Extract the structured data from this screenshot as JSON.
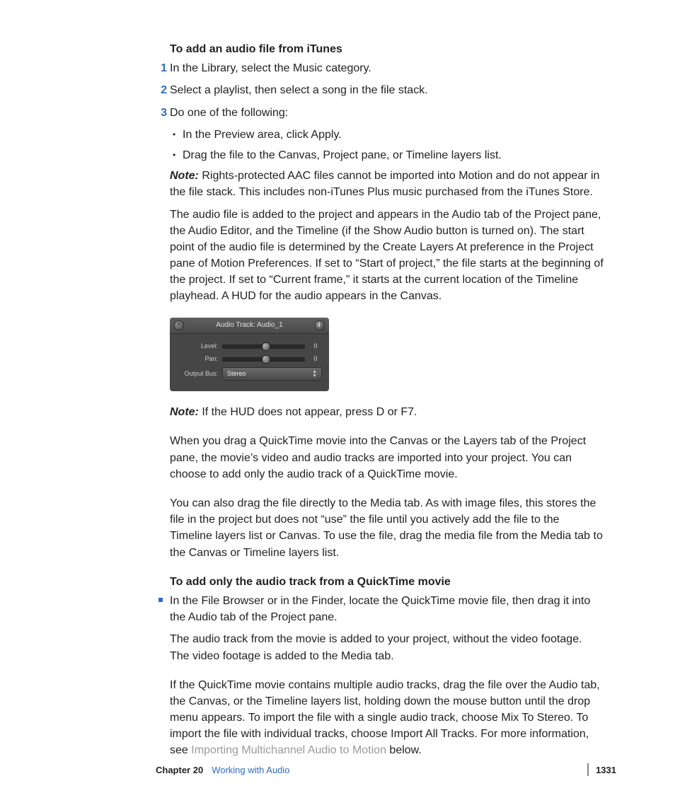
{
  "headings": {
    "h1": "To add an audio file from iTunes",
    "h2": "To add only the audio track from a QuickTime movie"
  },
  "steps": {
    "s1": "In the Library, select the Music category.",
    "s2": "Select a playlist, then select a song in the file stack.",
    "s3": "Do one of the following:"
  },
  "bullets": {
    "b1": "In the Preview area, click Apply.",
    "b2": "Drag the file to the Canvas, Project pane, or Timeline layers list."
  },
  "labels": {
    "note": "Note:",
    "step1": "1",
    "step2": "2",
    "step3": "3"
  },
  "paragraphs": {
    "note1_body": "  Rights-protected AAC files cannot be imported into Motion and do not appear in the file stack. This includes non-iTunes Plus music purchased from the iTunes Store.",
    "p_afterNote1": "The audio file is added to the project and appears in the Audio tab of the Project pane, the Audio Editor, and the Timeline (if the Show Audio button is turned on). The start point of the audio file is determined by the Create Layers At preference in the Project pane of Motion Preferences. If set to “Start of project,” the file starts at the beginning of the project. If set to “Current frame,” it starts at the current location of the Timeline playhead. A HUD for the audio appears in the Canvas.",
    "note2_body": "  If the HUD does not appear, press D or F7.",
    "p_quicktime1": "When you drag a QuickTime movie into the Canvas or the Layers tab of the Project pane, the movie’s video and audio tracks are imported into your project. You can choose to add only the audio track of a QuickTime movie.",
    "p_quicktime2": "You can also drag the file directly to the Media tab. As with image files, this stores the file in the project but does not “use” the file until you actively add the file to the Timeline layers list or Canvas. To use the file, drag the media file from the Media tab to the Canvas or Timeline layers list.",
    "sq1": "In the File Browser or in the Finder, locate the QuickTime movie file, then drag it into the Audio tab of the Project pane.",
    "p_audioTrackAdded": "The audio track from the movie is added to your project, without the video footage. The video footage is added to the Media tab.",
    "p_multitrack_a": "If the QuickTime movie contains multiple audio tracks, drag the file over the Audio tab, the Canvas, or the Timeline layers list, holding down the mouse button until the drop menu appears. To import the file with a single audio track, choose Mix To Stereo. To import the file with individual tracks, choose Import All Tracks. For more information, see ",
    "link_multichannel": "Importing Multichannel Audio to Motion",
    "p_multitrack_b": " below."
  },
  "hud": {
    "title": "Audio Track: Audio_1",
    "level_label": "Level:",
    "pan_label": "Pan:",
    "output_label": "Output Bus:",
    "level_value": "0",
    "pan_value": "0",
    "output_value": "Stereo"
  },
  "footer": {
    "chapter": "Chapter 20",
    "title": "Working with Audio",
    "page": "1331"
  }
}
